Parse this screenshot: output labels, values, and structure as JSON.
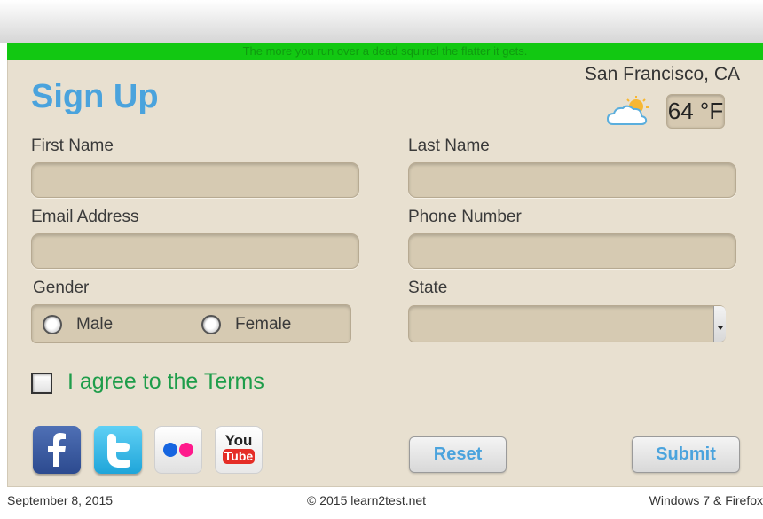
{
  "ticker": "The more you run over a dead squirrel the flatter it gets.",
  "form": {
    "title": "Sign Up",
    "first_name_label": "First Name",
    "last_name_label": "Last Name",
    "email_label": "Email Address",
    "phone_label": "Phone Number",
    "gender_label": "Gender",
    "gender_options": [
      "Male",
      "Female"
    ],
    "state_label": "State",
    "terms_label": "I agree to the Terms",
    "reset_label": "Reset",
    "submit_label": "Submit"
  },
  "weather": {
    "city": "San Francisco, CA",
    "temperature": "64 °F",
    "icon": "partly-cloudy-icon"
  },
  "social": {
    "icons": [
      "facebook-icon",
      "twitter-icon",
      "flickr-icon",
      "youtube-icon"
    ],
    "youtube_text_top": "You",
    "youtube_text_bottom": "Tube"
  },
  "footer": {
    "date": "September 8, 2015",
    "copyright": "© 2015 learn2test.net",
    "platform": "Windows 7 & Firefox"
  },
  "colors": {
    "accent_blue": "#4aa3dd",
    "terms_green": "#1e9d4a",
    "ticker_green": "#12c812",
    "panel_bg": "#e8e0d0"
  }
}
